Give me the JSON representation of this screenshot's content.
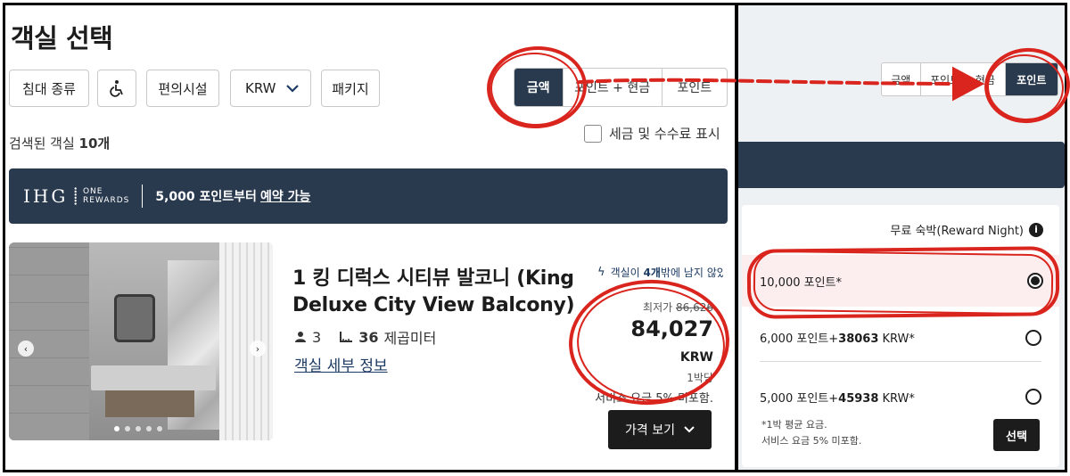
{
  "page": {
    "title": "객실 선택"
  },
  "filters": {
    "bed_type": "침대 종류",
    "accessibility_icon": "wheelchair-icon",
    "amenities": "편의시설",
    "currency": "KRW",
    "package": "패키지"
  },
  "rate_toggle": {
    "options": [
      "금액",
      "포인트 + 현금",
      "포인트"
    ],
    "selected": "금액"
  },
  "results": {
    "prefix": "검색된 객실 ",
    "count": "10개"
  },
  "tax_toggle": {
    "label": "세금 및 수수료 표시",
    "checked": false
  },
  "banner": {
    "brand": "IHG",
    "brand_sub_1": "ONE",
    "brand_sub_2": "REWARDS",
    "text": "5,000 포인트부터",
    "link": "예약 가능"
  },
  "room": {
    "name": "1 킹 디럭스 시티뷰 발코니 (King Deluxe City View Balcony)",
    "guests": "3",
    "size": "36",
    "size_unit": "제곱미터",
    "details_link": "객실 세부 정보",
    "availability_prefix": "객실이 ",
    "availability_count": "4개",
    "availability_suffix": "밖에 남지 않았습니다",
    "price_from_label": "최저가",
    "price_original": "86,626",
    "price": "84,027",
    "currency": "KRW",
    "per_night": "1박당",
    "service_note": "서비스 요금 5% 미포함.",
    "price_button": "가격 보기",
    "photo_count": 5,
    "photo_active_index": 0
  },
  "reward_panel": {
    "mini_toggle": {
      "options": [
        "금액",
        "포인트 + 현금",
        "포인트"
      ],
      "selected": "포인트"
    },
    "header": "무료 숙박(Reward Night)",
    "options": [
      {
        "points": "10,000",
        "points_label": "포인트*",
        "cash": "",
        "selected": true
      },
      {
        "points": "6,000",
        "points_label": "포인트",
        "cash": "38063",
        "cash_label": "KRW*",
        "selected": false
      },
      {
        "points": "5,000",
        "points_label": "포인트",
        "cash": "45938",
        "cash_label": "KRW*",
        "selected": false
      }
    ],
    "footnote_1": "*1박 평균 요금.",
    "footnote_2": "서비스 요금 5% 미포함.",
    "select_button": "선택"
  },
  "colors": {
    "navy": "#2a3a4e",
    "annotation_red": "#d9251d",
    "selected_bg": "#fceeee",
    "link": "#1d3b63"
  }
}
